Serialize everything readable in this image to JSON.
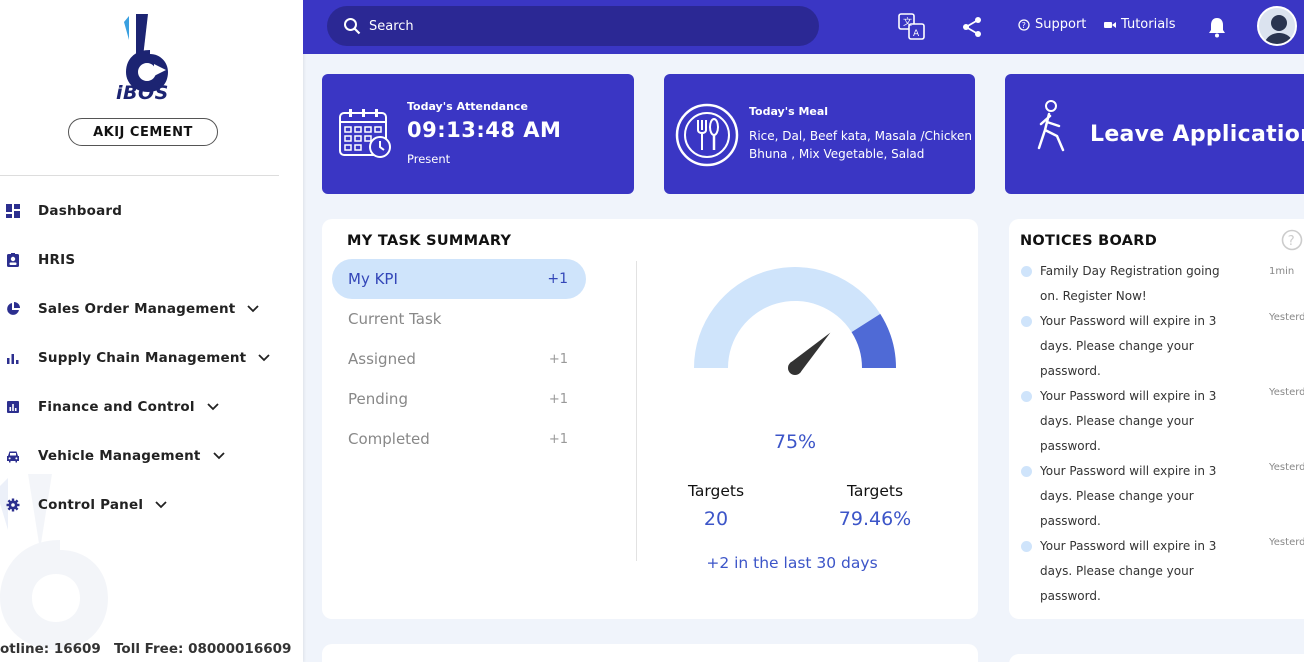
{
  "brand": {
    "name": "iBOS",
    "company": "AKIJ CEMENT"
  },
  "sidebar": {
    "items": [
      {
        "label": "Dashboard",
        "icon": "dashboard-icon",
        "has_submenu": false
      },
      {
        "label": "HRIS",
        "icon": "id-badge-icon",
        "has_submenu": false
      },
      {
        "label": "Sales Order Management",
        "icon": "pie-chart-icon",
        "has_submenu": true
      },
      {
        "label": "Supply Chain Management",
        "icon": "bar-chart-icon",
        "has_submenu": true
      },
      {
        "label": "Finance and Control",
        "icon": "finance-chart-icon",
        "has_submenu": true
      },
      {
        "label": "Vehicle Management",
        "icon": "car-icon",
        "has_submenu": true
      },
      {
        "label": "Control Panel",
        "icon": "gear-icon",
        "has_submenu": true
      }
    ],
    "footer": {
      "hotline": "otline: 16609",
      "tollfree": "Toll Free: 08000016609"
    }
  },
  "topbar": {
    "search_label": "Search",
    "support_label": "Support",
    "tutorials_label": "Tutorials"
  },
  "cards": {
    "attendance": {
      "title": "Today's Attendance",
      "time": "09:13:48 AM",
      "status": "Present"
    },
    "meal": {
      "title": "Today's Meal",
      "menu": "Rice, Dal, Beef kata, Masala /Chicken Bhuna , Mix Vegetable, Salad"
    },
    "leave": {
      "title": "Leave Application"
    }
  },
  "task_summary": {
    "title": "MY TASK SUMMARY",
    "items": [
      {
        "label": "My KPI",
        "count": "+1",
        "active": true
      },
      {
        "label": "Current Task",
        "count": "",
        "active": false
      },
      {
        "label": "Assigned",
        "count": "+1",
        "active": false
      },
      {
        "label": "Pending",
        "count": "+1",
        "active": false
      },
      {
        "label": "Completed",
        "count": "+1",
        "active": false
      }
    ],
    "gauge": {
      "percent": "75%",
      "value": 75
    },
    "targets": [
      {
        "label": "Targets",
        "value": "20"
      },
      {
        "label": "Targets",
        "value": "79.46%"
      }
    ],
    "trend": "+2 in the last 30 days"
  },
  "notices": {
    "title": "NOTICES BOARD",
    "items": [
      {
        "text": "Family Day Registration going on. Register Now!",
        "time": "1min"
      },
      {
        "text": "Your Password will expire in 3 days. Please change your password.",
        "time": "Yesterday"
      },
      {
        "text": "Your Password will expire in 3 days. Please change your password.",
        "time": "Yesterday"
      },
      {
        "text": "Your Password will expire in 3 days. Please change your password.",
        "time": "Yesterday"
      },
      {
        "text": "Your Password will expire in 3 days. Please change your password.",
        "time": "Yesterday"
      }
    ]
  },
  "colors": {
    "primary": "#3a36c4",
    "search_bg": "#2b2894",
    "accent_text": "#3c55c8",
    "active_pill": "#cfe4fb",
    "nav_icon": "#2c2f8f"
  }
}
